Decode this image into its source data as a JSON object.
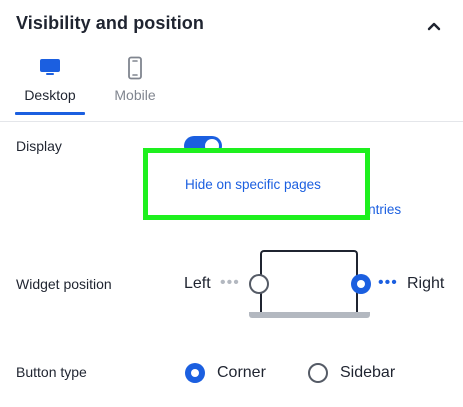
{
  "section": {
    "title": "Visibility and position",
    "collapse_icon": "chevron-up-icon"
  },
  "tabs": [
    {
      "label": "Desktop",
      "icon": "desktop-icon",
      "active": true
    },
    {
      "label": "Mobile",
      "icon": "mobile-icon",
      "active": false
    }
  ],
  "display": {
    "label": "Display",
    "enabled": true,
    "links": {
      "hide_pages": "Hide on specific pages",
      "hide_countries_partial": "Hide or display for specific countries",
      "hide_countries_visible_tail": "ountries"
    }
  },
  "widget_position": {
    "label": "Widget position",
    "left_label": "Left",
    "right_label": "Right",
    "selected": "Right"
  },
  "button_type": {
    "label": "Button type",
    "options": [
      "Corner",
      "Sidebar"
    ],
    "selected": "Corner"
  },
  "colors": {
    "accent": "#1b5fe0",
    "highlight": "#1ef01e",
    "text": "#1f2430",
    "muted": "#80858f"
  }
}
